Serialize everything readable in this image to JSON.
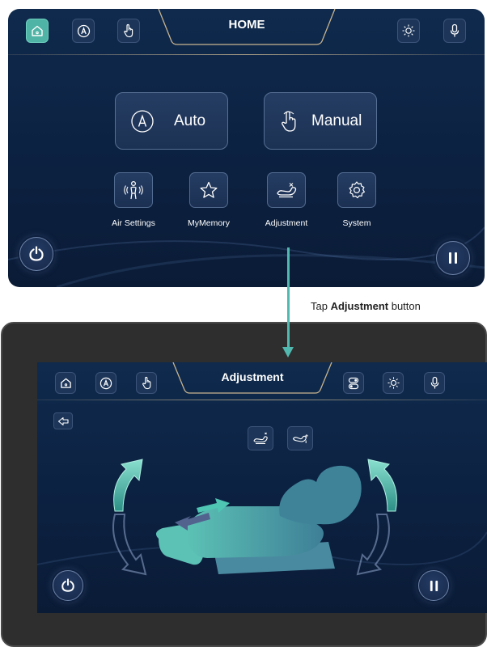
{
  "colors": {
    "accent": "#4fb3a5",
    "arrow": "#52b9b0",
    "screen_bg": "#0f2a4d"
  },
  "home_screen": {
    "title": "HOME",
    "topbar_icons": [
      "home-icon",
      "auto-a-icon",
      "hand-pointer-icon",
      "light-icon",
      "microphone-icon"
    ],
    "auto_label": "Auto",
    "manual_label": "Manual",
    "functions": [
      {
        "label": "Air Settings",
        "icon": "air-settings-icon"
      },
      {
        "label": "MyMemory",
        "icon": "star-icon"
      },
      {
        "label": "Adjustment",
        "icon": "adjustment-icon"
      },
      {
        "label": "System",
        "icon": "gear-icon"
      }
    ]
  },
  "callout": {
    "prefix": "Tap",
    "bold": "Adjustment",
    "suffix": "button"
  },
  "adjust_screen": {
    "title": "Adjustment",
    "topbar_icons": [
      "home-icon",
      "auto-a-icon",
      "hand-pointer-icon",
      "toggle-icon",
      "light-icon",
      "microphone-icon"
    ],
    "mode_icons": [
      "recline-mode-icon",
      "zero-gravity-icon"
    ]
  }
}
